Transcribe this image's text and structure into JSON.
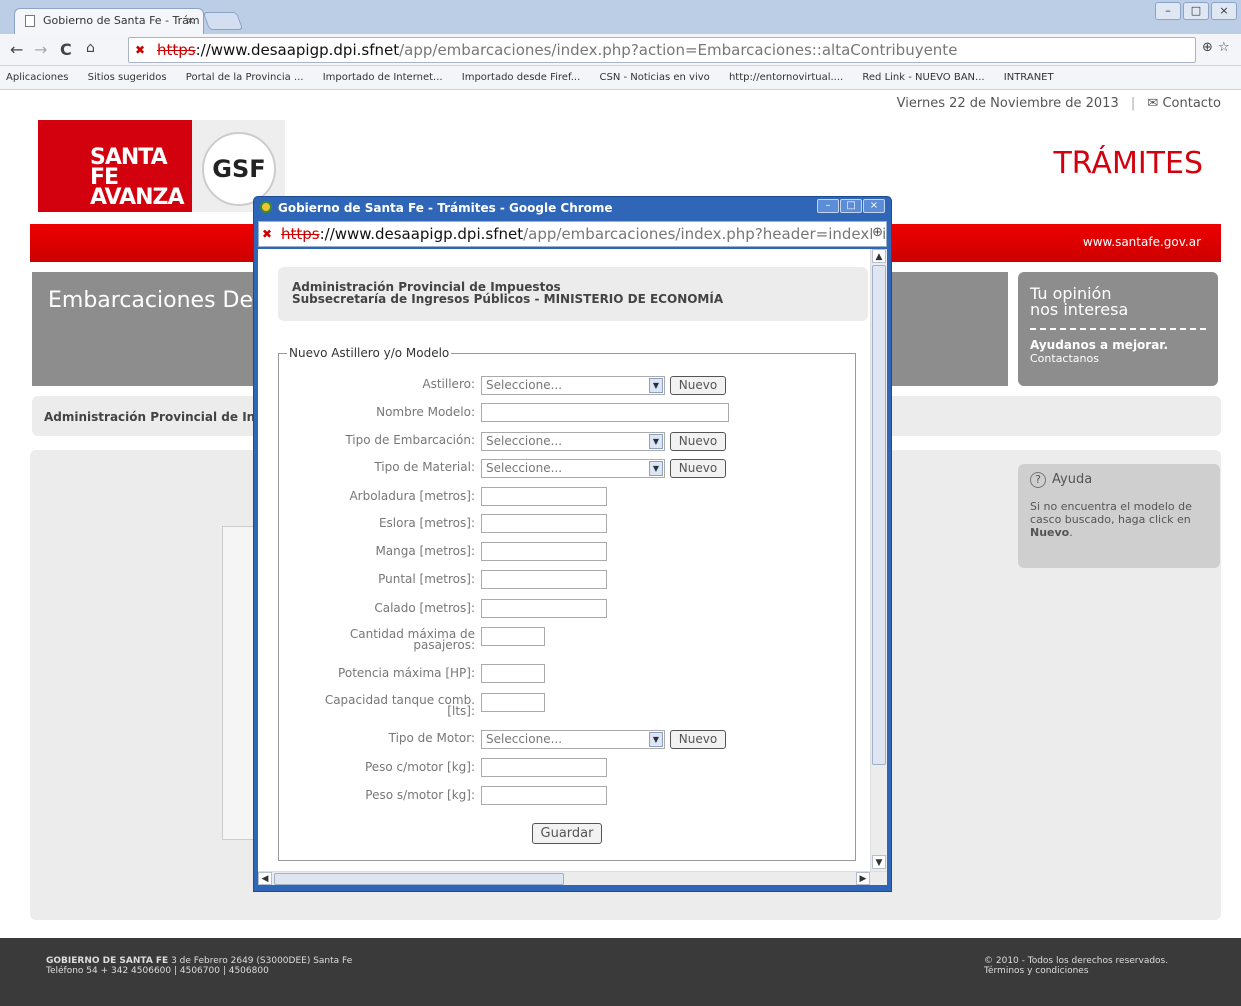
{
  "browser": {
    "tab_title": "Gobierno de Santa Fe - Trám",
    "tab_close": "×",
    "url_scheme": "https",
    "url_host": "://www.desaapigp.dpi.sfnet",
    "url_path": "/app/embarcaciones/index.php?action=Embarcaciones::altaContribuyente",
    "bookmarks": [
      "Aplicaciones",
      "Sitios sugeridos",
      "Portal de la Provincia ...",
      "Importado de Internet...",
      "Importado desde Firef...",
      "CSN - Noticias en vivo",
      "http://entornovirtual....",
      "Red Link - NUEVO BAN...",
      "INTRANET"
    ]
  },
  "page": {
    "date": "Viernes 22 de Noviembre de 2013",
    "contact": "Contacto",
    "logo_line1": "SANTA FE",
    "logo_line2": "AVANZA",
    "logo_gsf": "GSF",
    "tramites": "TRÁMITES",
    "site_url": "www.santafe.gov.ar",
    "section_title": "Embarcaciones De",
    "opinion_title1": "Tu opinión",
    "opinion_title2": "nos interesa",
    "opinion_sub": "Ayudanos a mejorar.",
    "opinion_link": "Contactanos",
    "breadcrumb": "Administración Provincial de In",
    "help_title": "Ayuda",
    "help_text_a": "Si no encuentra el modelo de casco buscado, haga click en ",
    "help_text_b": "Nuevo",
    "help_text_c": ".",
    "footer_left_bold": "GOBIERNO DE SANTA FE",
    "footer_left_addr": " 3 de Febrero 2649 (S3000DEE) Santa Fe",
    "footer_left_tel": "Teléfono 54 + 342 4506600 | 4506700 | 4506800",
    "footer_right1": "© 2010 - Todos los derechos reservados.",
    "footer_right2": "Términos y condiciones"
  },
  "popup": {
    "title": "Gobierno de Santa Fe - Trámites - Google Chrome",
    "url_scheme": "https",
    "url_host": "://www.desaapigp.dpi.sfnet",
    "url_path": "/app/embarcaciones/index.php?header=indexMin&",
    "header_line1": "Administración Provincial de Impuestos",
    "header_line2": "Subsecretaría de Ingresos Públicos - MINISTERIO DE ECONOMÍA",
    "legend": "Nuevo Astillero y/o Modelo",
    "select_placeholder": "Seleccione...",
    "nuevo": "Nuevo",
    "fields": {
      "astillero": "Astillero:",
      "nombre_modelo": "Nombre Modelo:",
      "tipo_embarcacion": "Tipo de Embarcación:",
      "tipo_material": "Tipo de Material:",
      "arboladura": "Arboladura [metros]:",
      "eslora": "Eslora [metros]:",
      "manga": "Manga [metros]:",
      "puntal": "Puntal [metros]:",
      "calado": "Calado [metros]:",
      "cantidad_1": "Cantidad máxima de",
      "cantidad_2": "pasajeros:",
      "potencia": "Potencia máxima [HP]:",
      "capacidad_1": "Capacidad tanque comb.",
      "capacidad_2": "[lts]:",
      "tipo_motor": "Tipo de Motor:",
      "peso_c": "Peso c/motor [kg]:",
      "peso_s": "Peso s/motor [kg]:"
    },
    "guardar": "Guardar"
  }
}
